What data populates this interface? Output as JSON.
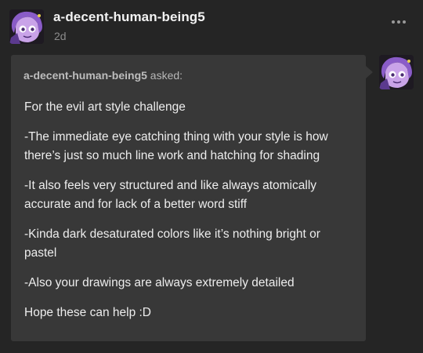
{
  "post": {
    "username": "a-decent-human-being5",
    "timestamp": "2d"
  },
  "ask": {
    "asker": "a-decent-human-being5",
    "asked_label": "asked:",
    "paragraphs": [
      "For the evil art style challenge",
      "-The immediate eye catching thing with your style is how there’s just so much line work and hatching for shading",
      "-It also feels very structured and like always atomically accurate and for lack of a better word stiff",
      "-Kinda dark desaturated colors like it’s nothing bright or pastel",
      "-Also your drawings are always extremely detailed",
      "Hope these can help :D"
    ]
  },
  "icons": {
    "more": "more-options-icon",
    "avatar": "avatar"
  },
  "colors": {
    "background": "#252525",
    "bubble": "#383838",
    "avatar_purple": "#8a5cc8"
  }
}
